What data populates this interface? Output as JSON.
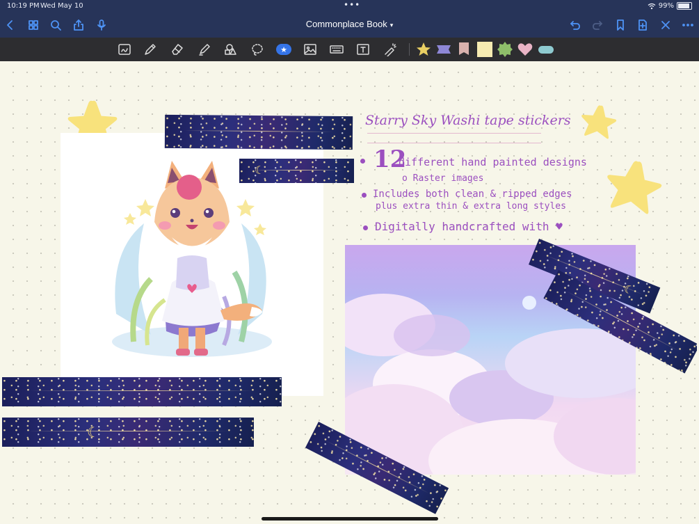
{
  "status": {
    "time": "10:19 PM",
    "date": "Wed May 10",
    "battery": "99%",
    "battery_level": 0.99
  },
  "nav": {
    "title": "Commonplace Book"
  },
  "icons": {
    "back": "chevron-left-icon",
    "grid": "grid-icon",
    "search": "search-icon",
    "share": "share-icon",
    "mic": "microphone-icon",
    "undo": "undo-icon",
    "redo": "redo-icon",
    "bookmark": "bookmark-icon",
    "add_page": "add-page-icon",
    "close": "close-icon",
    "more": "more-icon"
  },
  "tools": [
    "zoom-window-icon",
    "pen-icon",
    "eraser-icon",
    "highlighter-icon",
    "shapes-icon",
    "lasso-icon",
    "sticker-icon",
    "image-icon",
    "keyboard-icon",
    "text-icon",
    "laser-pointer-icon"
  ],
  "colors": {
    "nav_bg": "#273459",
    "toolbar_bg": "#2d2d30",
    "accent": "#4e93f5",
    "ink": "#9b4fbf",
    "canvas_bg": "#f7f6e9",
    "star_yellow": "#f8e27c"
  },
  "notes": {
    "title": "Starry Sky Washi tape stickers",
    "count": "12",
    "line1": "different hand painted designs",
    "line1_sub": "o Raster images",
    "line2a": "Includes both clean & ripped edges",
    "line2b": "plus extra thin & extra long styles",
    "line3": "Digitally handcrafted with"
  }
}
